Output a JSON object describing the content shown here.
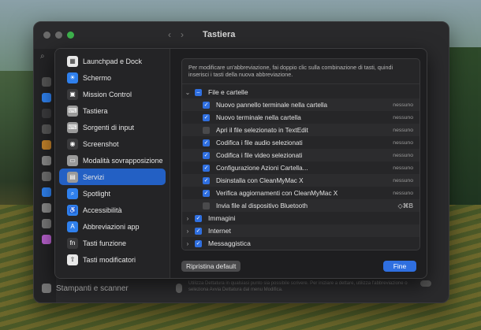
{
  "window": {
    "title": "Tastiera",
    "bottom_item": "Stampanti e scanner",
    "background_text": "Utilizza Dettatura in qualsiasi punto sia possibile scrivere. Per iniziare a dettare, utilizza l'abbreviazione o seleziona Avvia Dettatura dal menu Modifica."
  },
  "categories": [
    {
      "label": "Launchpad e Dock",
      "icon": "launchpad-icon",
      "color": "#e8e8e8",
      "glyph": "▦"
    },
    {
      "label": "Schermo",
      "icon": "display-icon",
      "color": "#2f80ed",
      "glyph": "☀"
    },
    {
      "label": "Mission Control",
      "icon": "mission-control-icon",
      "color": "#3a3a3c",
      "glyph": "▣"
    },
    {
      "label": "Tastiera",
      "icon": "keyboard-icon",
      "color": "#9a9a9a",
      "glyph": "⌨"
    },
    {
      "label": "Sorgenti di input",
      "icon": "input-sources-icon",
      "color": "#9a9a9a",
      "glyph": "⌨"
    },
    {
      "label": "Screenshot",
      "icon": "screenshot-icon",
      "color": "#3a3a3c",
      "glyph": "◉"
    },
    {
      "label": "Modalità sovrapposizione",
      "icon": "overlay-icon",
      "color": "#9a9a9a",
      "glyph": "▭"
    },
    {
      "label": "Servizi",
      "icon": "services-icon",
      "color": "#9a9a9a",
      "glyph": "▤"
    },
    {
      "label": "Spotlight",
      "icon": "spotlight-icon",
      "color": "#2f80ed",
      "glyph": "⌕"
    },
    {
      "label": "Accessibilità",
      "icon": "accessibility-icon",
      "color": "#2f80ed",
      "glyph": "♿"
    },
    {
      "label": "Abbreviazioni app",
      "icon": "app-shortcuts-icon",
      "color": "#2f80ed",
      "glyph": "A"
    },
    {
      "label": "Tasti funzione",
      "icon": "function-keys-icon",
      "color": "#3a3a3c",
      "glyph": "fn"
    },
    {
      "label": "Tasti modificatori",
      "icon": "modifier-keys-icon",
      "color": "#e8e8e8",
      "glyph": "⇧"
    }
  ],
  "selected_category": "Servizi",
  "hint": "Per modificare un'abbreviazione, fai doppio clic sulla combinazione di tasti, quindi inserisci i tasti della nuova abbreviazione.",
  "rows": [
    {
      "kind": "group",
      "chevron": "⌄",
      "state": "mixed",
      "label": "File e cartelle",
      "shortcut": ""
    },
    {
      "kind": "item",
      "state": "on",
      "label": "Nuovo pannello terminale nella cartella",
      "shortcut": "nessuno"
    },
    {
      "kind": "item",
      "state": "on",
      "label": "Nuovo terminale nella cartella",
      "shortcut": "nessuno"
    },
    {
      "kind": "item",
      "state": "off",
      "label": "Apri il file selezionato in TextEdit",
      "shortcut": "nessuno"
    },
    {
      "kind": "item",
      "state": "on",
      "label": "Codifica i file audio selezionati",
      "shortcut": "nessuno"
    },
    {
      "kind": "item",
      "state": "on",
      "label": "Codifica i file video selezionati",
      "shortcut": "nessuno"
    },
    {
      "kind": "item",
      "state": "on",
      "label": "Configurazione Azioni Cartella...",
      "shortcut": "nessuno"
    },
    {
      "kind": "item",
      "state": "on",
      "label": "Disinstalla con CleanMyMac X",
      "shortcut": "nessuno"
    },
    {
      "kind": "item",
      "state": "on",
      "label": "Verifica aggiornamenti con CleanMyMac X",
      "shortcut": "nessuno"
    },
    {
      "kind": "item",
      "state": "off",
      "label": "Invia file al dispositivo Bluetooth",
      "shortcut": "◇⌘B"
    },
    {
      "kind": "group",
      "chevron": "›",
      "state": "on",
      "label": "Immagini",
      "shortcut": ""
    },
    {
      "kind": "group",
      "chevron": "›",
      "state": "on",
      "label": "Internet",
      "shortcut": ""
    },
    {
      "kind": "group",
      "chevron": "›",
      "state": "on",
      "label": "Messaggistica",
      "shortcut": ""
    }
  ],
  "buttons": {
    "reset": "Ripristina default",
    "done": "Fine"
  },
  "colors": {
    "accent": "#2f6fe0",
    "selection": "#2360c4"
  }
}
